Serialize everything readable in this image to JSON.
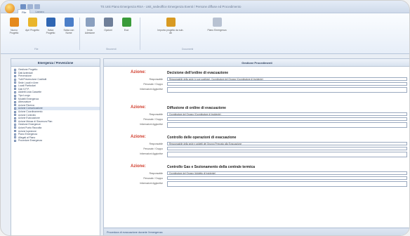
{
  "window": {
    "title": "TS Unit Piano Emergenza RSA - Unit_sedeoffice Emergenza Eventi / Persone diffuse ed Procedimento",
    "tabs": [
      "File",
      "Lavoro"
    ]
  },
  "ribbon": {
    "buttons": [
      {
        "label": "Nuovo Progetto",
        "color": "#e58a1c"
      },
      {
        "label": "Apri Progetto",
        "color": "#e9b52b"
      },
      {
        "label": "Salva Progetto",
        "color": "#2f66b3"
      },
      {
        "label": "Salva con Nome",
        "color": "#4b7ec8"
      },
      {
        "label": "Invia Adesione",
        "color": "#8aa0bf"
      },
      {
        "label": "Opzioni",
        "color": "#6f7f99"
      },
      {
        "label": "Esci",
        "color": "#3a9b3a"
      },
      {
        "label": "Importa progetto da sub-db",
        "color": "#d89a22"
      },
      {
        "label": "Piano Emergenza",
        "color": "#b8c2d2"
      }
    ],
    "groups": [
      "File",
      "Strumenti",
      "Documenti"
    ]
  },
  "left_panel": {
    "title": "Emergenza / Prevenzione",
    "items": [
      "Gestione Progetto",
      "Dati Aziendali",
      "Prevenzione",
      "Tutti Prevenzione Costituiti",
      "Sede Locali e Aree",
      "Locali Particolari",
      "Dati S.P.P.",
      "Addetti Lista Cassette",
      "Tipo Luogo",
      "Modelli Emergenza",
      "Attrezzature",
      "Azione Ricerca",
      "Azione Comunicazione",
      "Azione Coordinamento",
      "Azione Controllo",
      "Azione Evacuazione",
      "Azione Messa di Sicurezza Pian",
      "Gestione Emergenze",
      "Azioni Punto Raccolta",
      "Azione Ispezione",
      "Piano Emergenza",
      "Allegati al Piano",
      "Procedure Emergenza"
    ],
    "selected_index": 12
  },
  "right_panel": {
    "title": "Gestione Procedimenti",
    "action_label": "Azione:",
    "field_labels": [
      "Responsabile",
      "Personale / Gruppo",
      "Informazioni Aggiuntive"
    ],
    "actions": [
      {
        "title": "Decisione dell'ordine di evacuazione",
        "responsabile": "Responsabile della sede (o sue sostituto), Coordinatore del Gruppo (Coordinatore di Incidente)",
        "personale": "",
        "info": ""
      },
      {
        "title": "Diffusione di ordine di evacuazione",
        "responsabile": "Coordinatore del Gruppo (Coordinatore di Incidente)",
        "personale": "",
        "info": ""
      },
      {
        "title": "Controllo delle operazioni di evacuazione",
        "responsabile": "Responsabile della sede e addetti del Gruppo Preposto alla Evacuazione",
        "personale": "",
        "info": ""
      },
      {
        "title": "Controllo Gas e Sezionamento della centrale termica",
        "responsabile": "Coordinatore del Gruppo (Addetto di Incidente)",
        "personale": "",
        "info": ""
      }
    ],
    "footer": "Procedura di evacuazione durante l'emergenza"
  }
}
